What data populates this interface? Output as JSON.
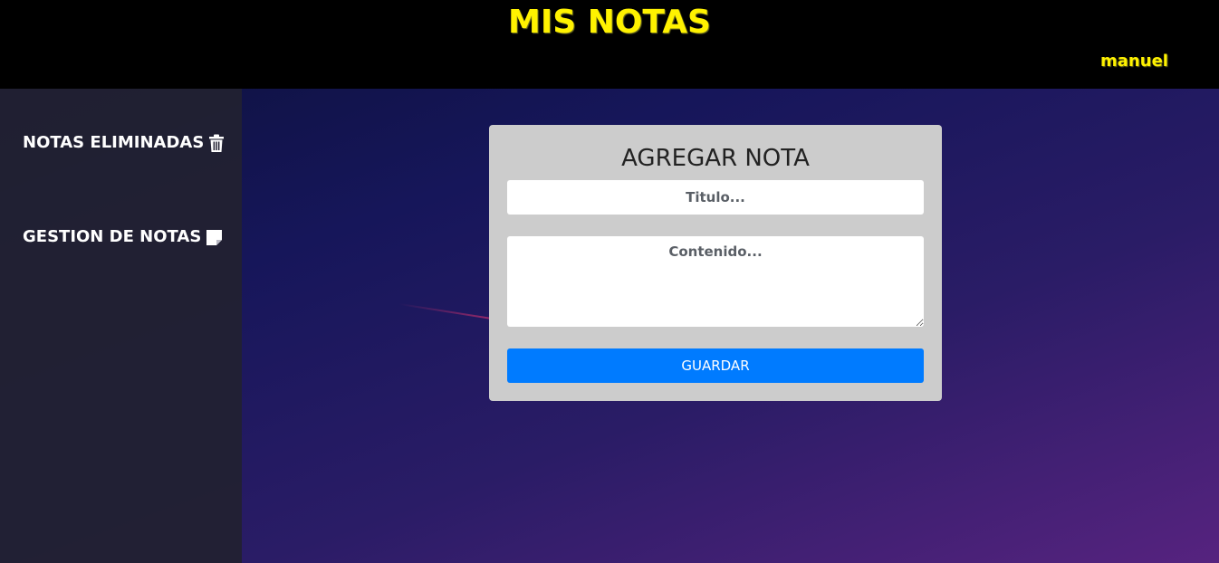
{
  "header": {
    "title": "MIS NOTAS",
    "user": "manuel"
  },
  "sidebar": {
    "items": [
      {
        "label": "NOTAS ELIMINADAS",
        "icon": "trash-icon"
      },
      {
        "label": "GESTION DE NOTAS",
        "icon": "note-icon"
      }
    ]
  },
  "form": {
    "heading": "AGREGAR NOTA",
    "title_placeholder": "Titulo...",
    "title_value": "",
    "content_placeholder": "Contenido...",
    "content_value": "",
    "save_label": "GUARDAR"
  },
  "colors": {
    "header_bg": "#000000",
    "accent_yellow": "#fff200",
    "primary_button": "#007bff",
    "card_bg": "#cccccc",
    "sidebar_bg": "#222132"
  }
}
